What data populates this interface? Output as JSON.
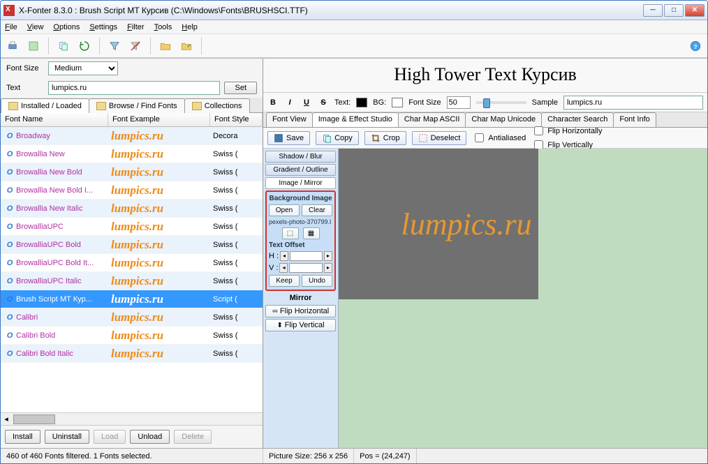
{
  "title": "X-Fonter 8.3.0  :  Brush Script MT Курсив (C:\\Windows\\Fonts\\BRUSHSCI.TTF)",
  "menu": {
    "file": "File",
    "view": "View",
    "options": "Options",
    "settings": "Settings",
    "filter": "Filter",
    "tools": "Tools",
    "help": "Help"
  },
  "left": {
    "fontsize_label": "Font Size",
    "fontsize_value": "Medium",
    "text_label": "Text",
    "text_value": "lumpics.ru",
    "set": "Set",
    "tabs": {
      "installed": "Installed / Loaded",
      "browse": "Browse / Find Fonts",
      "collections": "Collections"
    },
    "hdr": {
      "name": "Font Name",
      "example": "Font Example",
      "style": "Font Style"
    },
    "rows": [
      {
        "name": "Broadway",
        "ex": "lumpics.ru",
        "style": "Decora"
      },
      {
        "name": "Browallia New",
        "ex": "lumpics.ru",
        "style": "Swiss ("
      },
      {
        "name": "Browallia New Bold",
        "ex": "lumpics.ru",
        "style": "Swiss ("
      },
      {
        "name": "Browallia New Bold I...",
        "ex": "lumpics.ru",
        "style": "Swiss ("
      },
      {
        "name": "Browallia New Italic",
        "ex": "lumpics.ru",
        "style": "Swiss ("
      },
      {
        "name": "BrowalliaUPC",
        "ex": "lumpics.ru",
        "style": "Swiss ("
      },
      {
        "name": "BrowalliaUPC Bold",
        "ex": "lumpics.ru",
        "style": "Swiss ("
      },
      {
        "name": "BrowalliaUPC Bold It...",
        "ex": "lumpics.ru",
        "style": "Swiss ("
      },
      {
        "name": "BrowalliaUPC Italic",
        "ex": "lumpics.ru",
        "style": "Swiss ("
      },
      {
        "name": "Brush Script MT Кур...",
        "ex": "lumpics.ru",
        "style": "Script ("
      },
      {
        "name": "Calibri",
        "ex": "lumpics.ru",
        "style": "Swiss ("
      },
      {
        "name": "Calibri Bold",
        "ex": "lumpics.ru",
        "style": "Swiss ("
      },
      {
        "name": "Calibri Bold Italic",
        "ex": "lumpics.ru",
        "style": "Swiss ("
      }
    ],
    "buttons": {
      "install": "Install",
      "uninstall": "Uninstall",
      "load": "Load",
      "unload": "Unload",
      "delete": "Delete"
    }
  },
  "right": {
    "preview_title": "High Tower Text Курсив",
    "fmt": {
      "b": "B",
      "i": "I",
      "u": "U",
      "s": "S",
      "text": "Text:",
      "bg": "BG:",
      "fontsize": "Font Size",
      "fsval": "50",
      "sample": "Sample",
      "sample_val": "lumpics.ru"
    },
    "tabs": {
      "fontview": "Font View",
      "image": "Image & Effect Studio",
      "ascii": "Char Map ASCII",
      "unicode": "Char Map Unicode",
      "search": "Character Search",
      "info": "Font Info"
    },
    "tools": {
      "save": "Save",
      "copy": "Copy",
      "crop": "Crop",
      "deselect": "Deselect",
      "anti": "Antialiased",
      "fliph": "Flip Horizontally",
      "flipv": "Flip Vertically"
    },
    "side": {
      "shadow": "Shadow / Blur",
      "gradient": "Gradient / Outline",
      "imgmirror": "Image / Mirror",
      "bgimg": "Background Image",
      "open": "Open",
      "clear": "Clear",
      "file": "pexels-photo-370799.l",
      "textoff": "Text Offset",
      "h": "H :",
      "v": "V :",
      "keep": "Keep",
      "undo": "Undo",
      "mirror": "Mirror",
      "fliph": "Flip Horizontal",
      "flipv": "Flip Vertical"
    },
    "canvas_text": "lumpics.ru"
  },
  "status": {
    "left": "460 of 460 Fonts filtered.  1 Fonts selected.",
    "picsize": "Picture Size: 256 x 256",
    "pos": "Pos = (24,247)"
  }
}
